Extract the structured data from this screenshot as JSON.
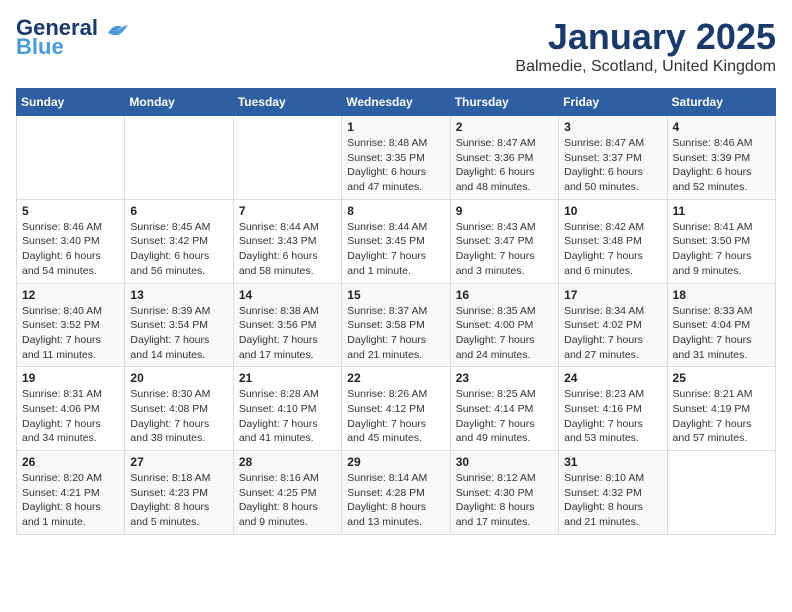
{
  "header": {
    "logo_line1": "General",
    "logo_line2": "Blue",
    "month": "January 2025",
    "location": "Balmedie, Scotland, United Kingdom"
  },
  "days_of_week": [
    "Sunday",
    "Monday",
    "Tuesday",
    "Wednesday",
    "Thursday",
    "Friday",
    "Saturday"
  ],
  "weeks": [
    [
      {
        "day": "",
        "info": ""
      },
      {
        "day": "",
        "info": ""
      },
      {
        "day": "",
        "info": ""
      },
      {
        "day": "1",
        "info": "Sunrise: 8:48 AM\nSunset: 3:35 PM\nDaylight: 6 hours and 47 minutes."
      },
      {
        "day": "2",
        "info": "Sunrise: 8:47 AM\nSunset: 3:36 PM\nDaylight: 6 hours and 48 minutes."
      },
      {
        "day": "3",
        "info": "Sunrise: 8:47 AM\nSunset: 3:37 PM\nDaylight: 6 hours and 50 minutes."
      },
      {
        "day": "4",
        "info": "Sunrise: 8:46 AM\nSunset: 3:39 PM\nDaylight: 6 hours and 52 minutes."
      }
    ],
    [
      {
        "day": "5",
        "info": "Sunrise: 8:46 AM\nSunset: 3:40 PM\nDaylight: 6 hours and 54 minutes."
      },
      {
        "day": "6",
        "info": "Sunrise: 8:45 AM\nSunset: 3:42 PM\nDaylight: 6 hours and 56 minutes."
      },
      {
        "day": "7",
        "info": "Sunrise: 8:44 AM\nSunset: 3:43 PM\nDaylight: 6 hours and 58 minutes."
      },
      {
        "day": "8",
        "info": "Sunrise: 8:44 AM\nSunset: 3:45 PM\nDaylight: 7 hours and 1 minute."
      },
      {
        "day": "9",
        "info": "Sunrise: 8:43 AM\nSunset: 3:47 PM\nDaylight: 7 hours and 3 minutes."
      },
      {
        "day": "10",
        "info": "Sunrise: 8:42 AM\nSunset: 3:48 PM\nDaylight: 7 hours and 6 minutes."
      },
      {
        "day": "11",
        "info": "Sunrise: 8:41 AM\nSunset: 3:50 PM\nDaylight: 7 hours and 9 minutes."
      }
    ],
    [
      {
        "day": "12",
        "info": "Sunrise: 8:40 AM\nSunset: 3:52 PM\nDaylight: 7 hours and 11 minutes."
      },
      {
        "day": "13",
        "info": "Sunrise: 8:39 AM\nSunset: 3:54 PM\nDaylight: 7 hours and 14 minutes."
      },
      {
        "day": "14",
        "info": "Sunrise: 8:38 AM\nSunset: 3:56 PM\nDaylight: 7 hours and 17 minutes."
      },
      {
        "day": "15",
        "info": "Sunrise: 8:37 AM\nSunset: 3:58 PM\nDaylight: 7 hours and 21 minutes."
      },
      {
        "day": "16",
        "info": "Sunrise: 8:35 AM\nSunset: 4:00 PM\nDaylight: 7 hours and 24 minutes."
      },
      {
        "day": "17",
        "info": "Sunrise: 8:34 AM\nSunset: 4:02 PM\nDaylight: 7 hours and 27 minutes."
      },
      {
        "day": "18",
        "info": "Sunrise: 8:33 AM\nSunset: 4:04 PM\nDaylight: 7 hours and 31 minutes."
      }
    ],
    [
      {
        "day": "19",
        "info": "Sunrise: 8:31 AM\nSunset: 4:06 PM\nDaylight: 7 hours and 34 minutes."
      },
      {
        "day": "20",
        "info": "Sunrise: 8:30 AM\nSunset: 4:08 PM\nDaylight: 7 hours and 38 minutes."
      },
      {
        "day": "21",
        "info": "Sunrise: 8:28 AM\nSunset: 4:10 PM\nDaylight: 7 hours and 41 minutes."
      },
      {
        "day": "22",
        "info": "Sunrise: 8:26 AM\nSunset: 4:12 PM\nDaylight: 7 hours and 45 minutes."
      },
      {
        "day": "23",
        "info": "Sunrise: 8:25 AM\nSunset: 4:14 PM\nDaylight: 7 hours and 49 minutes."
      },
      {
        "day": "24",
        "info": "Sunrise: 8:23 AM\nSunset: 4:16 PM\nDaylight: 7 hours and 53 minutes."
      },
      {
        "day": "25",
        "info": "Sunrise: 8:21 AM\nSunset: 4:19 PM\nDaylight: 7 hours and 57 minutes."
      }
    ],
    [
      {
        "day": "26",
        "info": "Sunrise: 8:20 AM\nSunset: 4:21 PM\nDaylight: 8 hours and 1 minute."
      },
      {
        "day": "27",
        "info": "Sunrise: 8:18 AM\nSunset: 4:23 PM\nDaylight: 8 hours and 5 minutes."
      },
      {
        "day": "28",
        "info": "Sunrise: 8:16 AM\nSunset: 4:25 PM\nDaylight: 8 hours and 9 minutes."
      },
      {
        "day": "29",
        "info": "Sunrise: 8:14 AM\nSunset: 4:28 PM\nDaylight: 8 hours and 13 minutes."
      },
      {
        "day": "30",
        "info": "Sunrise: 8:12 AM\nSunset: 4:30 PM\nDaylight: 8 hours and 17 minutes."
      },
      {
        "day": "31",
        "info": "Sunrise: 8:10 AM\nSunset: 4:32 PM\nDaylight: 8 hours and 21 minutes."
      },
      {
        "day": "",
        "info": ""
      }
    ]
  ]
}
